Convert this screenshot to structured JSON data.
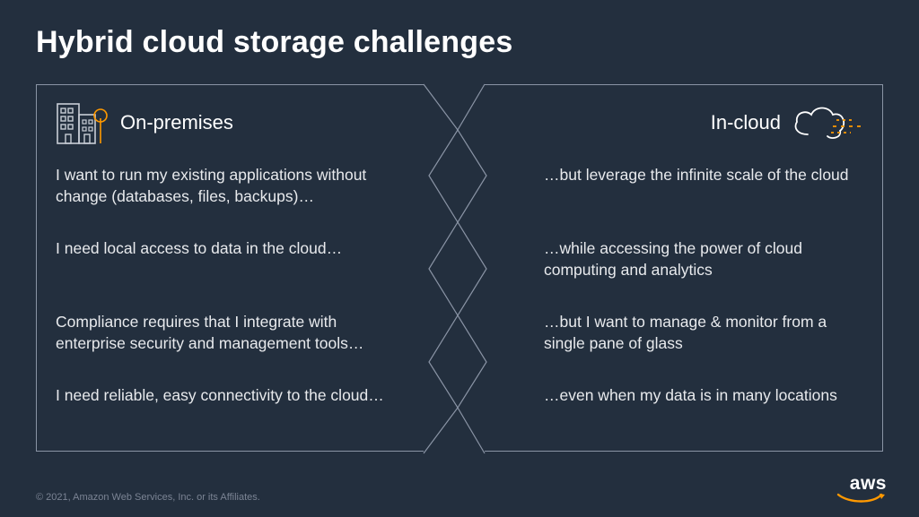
{
  "title": "Hybrid cloud storage challenges",
  "left": {
    "heading": "On-premises",
    "items": [
      "I want to run my existing applications without change (databases, files, backups)…",
      "I need local access to data in the cloud…",
      "Compliance requires that I integrate with enterprise security and management tools…",
      "I need reliable, easy connectivity to the cloud…"
    ]
  },
  "right": {
    "heading": "In-cloud",
    "items": [
      "…but leverage the infinite scale of the cloud",
      "…while accessing the power of cloud computing and analytics",
      "…but I want to manage & monitor from a single pane of glass",
      "…even when my data is in many locations"
    ]
  },
  "footer": "© 2021, Amazon Web Services, Inc. or its Affiliates.",
  "logo_text": "aws",
  "colors": {
    "accent": "#ff9900",
    "bg": "#232f3e",
    "line": "#8a94a5"
  }
}
